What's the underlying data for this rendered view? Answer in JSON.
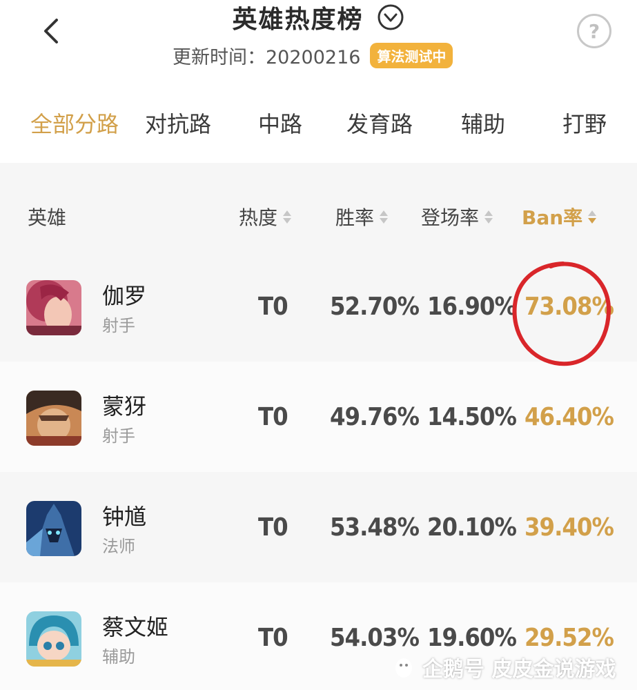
{
  "header": {
    "title": "英雄热度榜",
    "update_label": "更新时间：20200216",
    "algo_badge": "算法测试中",
    "help_symbol": "?"
  },
  "tabs": [
    {
      "label": "全部分路",
      "active": true
    },
    {
      "label": "对抗路",
      "active": false
    },
    {
      "label": "中路",
      "active": false
    },
    {
      "label": "发育路",
      "active": false
    },
    {
      "label": "辅助",
      "active": false
    },
    {
      "label": "打野",
      "active": false
    }
  ],
  "columns": {
    "hero": "英雄",
    "heat": "热度",
    "win": "胜率",
    "pick": "登场率",
    "ban": "Ban率"
  },
  "rows": [
    {
      "name": "伽罗",
      "role": "射手",
      "tier": "T0",
      "win": "52.70%",
      "pick": "16.90%",
      "ban": "73.08%",
      "avatar_colors": [
        "#b03a58",
        "#e9a1a8"
      ]
    },
    {
      "name": "蒙犽",
      "role": "射手",
      "tier": "T0",
      "win": "49.76%",
      "pick": "14.50%",
      "ban": "46.40%",
      "avatar_colors": [
        "#5b3a2a",
        "#d9a070"
      ]
    },
    {
      "name": "钟馗",
      "role": "法师",
      "tier": "T0",
      "win": "53.48%",
      "pick": "20.10%",
      "ban": "39.40%",
      "avatar_colors": [
        "#1c3b6e",
        "#6aa5d8"
      ]
    },
    {
      "name": "蔡文姬",
      "role": "辅助",
      "tier": "T0",
      "win": "54.03%",
      "pick": "19.60%",
      "ban": "29.52%",
      "avatar_colors": [
        "#2a8fb0",
        "#8fe0e8"
      ]
    }
  ],
  "watermark": "企鹅号 皮皮金说游戏",
  "colors": {
    "accent": "#d2a04a",
    "badge": "#f2b23c",
    "annotation": "#d9262a"
  }
}
